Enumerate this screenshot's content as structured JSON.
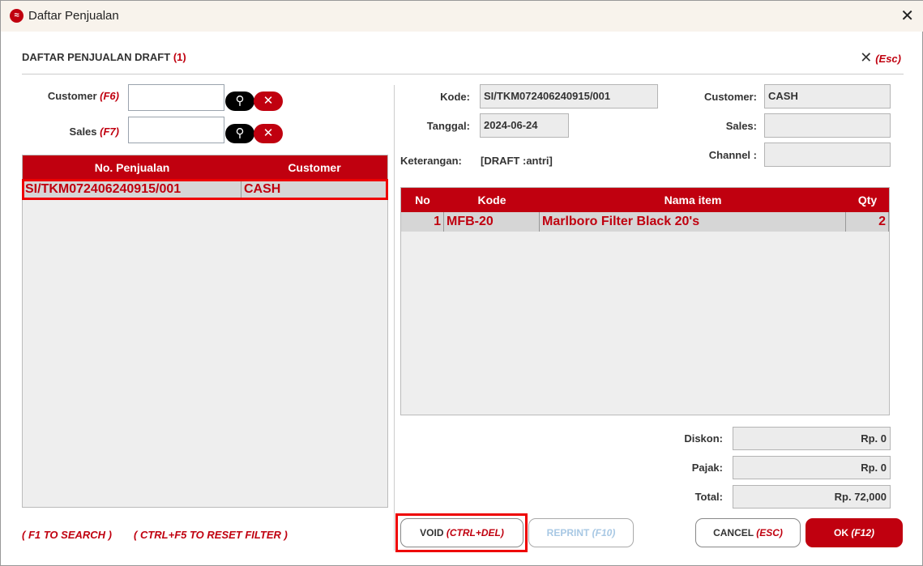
{
  "window": {
    "title": "Daftar Penjualan",
    "close_icon": "close-icon"
  },
  "header": {
    "title": "DAFTAR PENJUALAN DRAFT",
    "count": "(1)",
    "close_hint": "(Esc)"
  },
  "filters": {
    "customer_label": "Customer",
    "customer_key": "(F6)",
    "customer_value": "",
    "sales_label": "Sales",
    "sales_key": "(F7)",
    "sales_value": ""
  },
  "list": {
    "columns": [
      "No. Penjualan",
      "Customer"
    ],
    "rows": [
      {
        "no": "SI/TKM072406240915/001",
        "customer": "CASH"
      }
    ]
  },
  "hints": {
    "search": "( F1 TO SEARCH )",
    "reset": "( CTRL+F5 TO RESET FILTER )"
  },
  "detail": {
    "kode_label": "Kode:",
    "kode": "SI/TKM072406240915/001",
    "tanggal_label": "Tanggal:",
    "tanggal": "2024-06-24",
    "keterangan_label": "Keterangan:",
    "keterangan": "[DRAFT :antri]",
    "customer_label": "Customer:",
    "customer": "CASH",
    "sales_label": "Sales:",
    "sales": "",
    "channel_label": "Channel :",
    "channel": ""
  },
  "items": {
    "columns": [
      "No",
      "Kode",
      "Nama item",
      "Qty"
    ],
    "rows": [
      {
        "no": "1",
        "kode": "MFB-20",
        "nama": "Marlboro Filter Black 20's",
        "qty": "2"
      }
    ]
  },
  "totals": {
    "diskon_label": "Diskon:",
    "diskon": "Rp. 0",
    "pajak_label": "Pajak:",
    "pajak": "Rp. 0",
    "total_label": "Total:",
    "total": "Rp. 72,000"
  },
  "buttons": {
    "void": "VOID",
    "void_key": "(CTRL+DEL)",
    "reprint": "REPRINT",
    "reprint_key": "(F10)",
    "cancel": "CANCEL",
    "cancel_key": "(ESC)",
    "ok": "OK",
    "ok_key": "(F12)"
  },
  "colors": {
    "accent": "#c0000f"
  }
}
